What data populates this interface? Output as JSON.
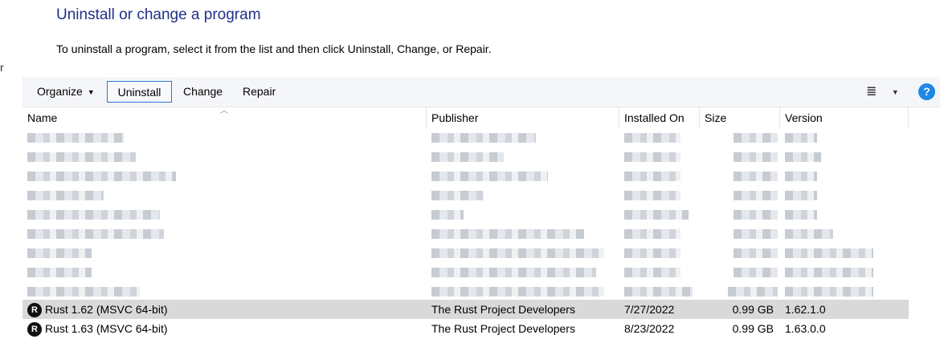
{
  "page": {
    "title": "Uninstall or change a program",
    "subtitle": "To uninstall a program, select it from the list and then click Uninstall, Change, or Repair.",
    "left_stub": "r"
  },
  "toolbar": {
    "organize": "Organize",
    "uninstall": "Uninstall",
    "change": "Change",
    "repair": "Repair",
    "help": "?"
  },
  "columns": {
    "name": "Name",
    "publisher": "Publisher",
    "installed_on": "Installed On",
    "size": "Size",
    "version": "Version"
  },
  "programs": [
    {
      "name": "Rust 1.62 (MSVC 64-bit)",
      "publisher": "The Rust Project Developers",
      "installed_on": "7/27/2022",
      "size": "0.99 GB",
      "version": "1.62.1.0",
      "selected": true
    },
    {
      "name": "Rust 1.63 (MSVC 64-bit)",
      "publisher": "The Rust Project Developers",
      "installed_on": "8/23/2022",
      "size": "0.99 GB",
      "version": "1.63.0.0",
      "selected": false
    }
  ]
}
